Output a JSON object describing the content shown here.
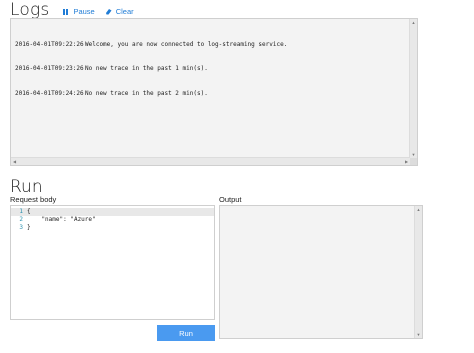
{
  "logs": {
    "title": "Logs",
    "pause_label": "Pause",
    "clear_label": "Clear",
    "lines": [
      {
        "time": "2016-04-01T09:22:26",
        "message": "Welcome, you are now connected to log-streaming service."
      },
      {
        "time": "2016-04-01T09:23:26",
        "message": "No new trace in the past 1 min(s)."
      },
      {
        "time": "2016-04-01T09:24:26",
        "message": "No new trace in the past 2 min(s)."
      }
    ]
  },
  "run": {
    "title": "Run",
    "request_body_label": "Request body",
    "output_label": "Output",
    "run_button_label": "Run",
    "editor_lines": [
      {
        "number": "1",
        "code": "{"
      },
      {
        "number": "2",
        "code": "    \"name\": \"Azure\""
      },
      {
        "number": "3",
        "code": "}"
      }
    ]
  },
  "icons": {
    "pause": "pause-icon",
    "clear": "clear-icon"
  },
  "colors": {
    "accent": "#1f7cd6",
    "button": "#4a9af0",
    "panel_bg": "#f3f3f3",
    "line_number": "#2b91af"
  }
}
